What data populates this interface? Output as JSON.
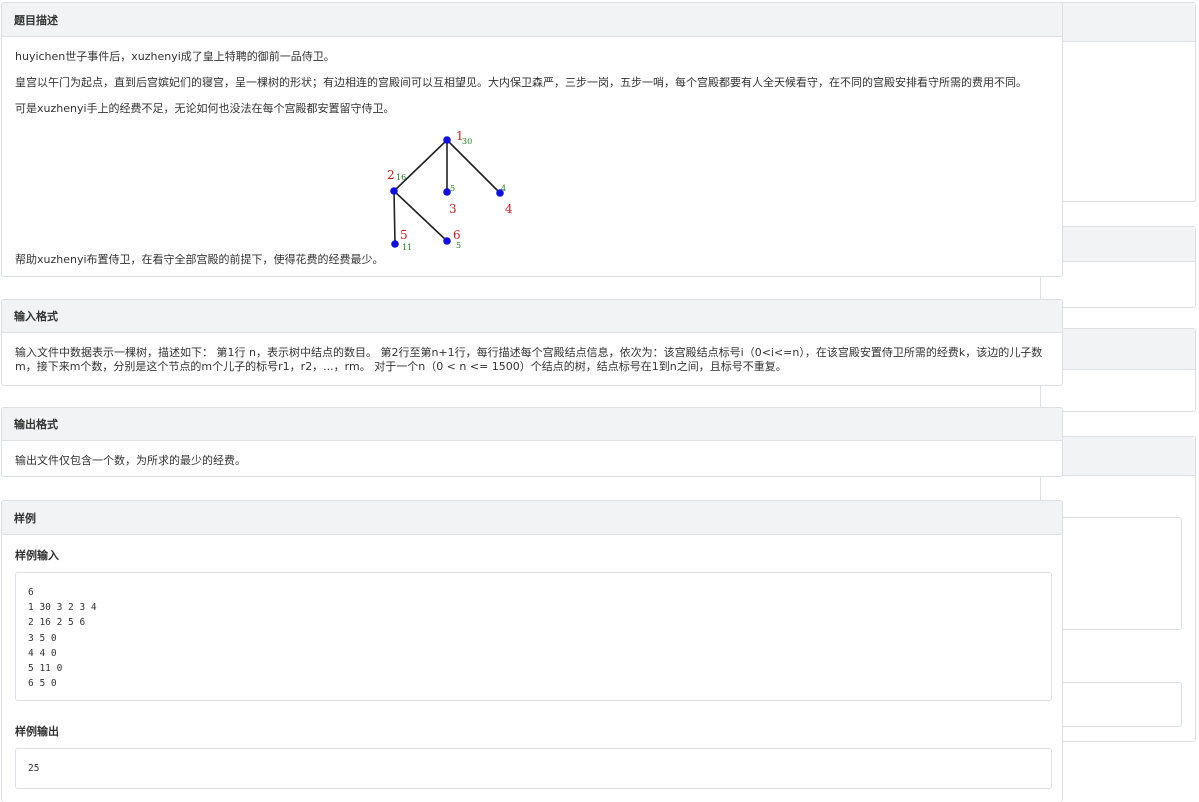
{
  "sections": {
    "description": {
      "title": "题目描述",
      "p1": "huyichen世子事件后，xuzhenyi成了皇上特聘的御前一品侍卫。",
      "p2": "皇宫以午门为起点，直到后宫嫔妃们的寝宫，呈一棵树的形状；有边相连的宫殿间可以互相望见。大内保卫森严，三步一岗，五步一哨，每个宫殿都要有人全天候看守，在不同的宫殿安排看守所需的费用不同。",
      "p3": "可是xuzhenyi手上的经费不足，无论如何也没法在每个宫殿都安置留守侍卫。",
      "p4": "帮助xuzhenyi布置侍卫，在看守全部宫殿的前提下，使得花费的经费最少。"
    },
    "input_format": {
      "title": "输入格式",
      "line1": "输入文件中数据表示一棵树，描述如下： 第1行 n，表示树中结点的数目。 第2行至第n+1行，每行描述每个宫殿结点信息，依次为：该宫殿结点标号i（0<i<=n），在该宫殿安置侍卫所需的经费k，该边的儿子数",
      "line2": "m，接下来m个数，分别是这个节点的m个儿子的标号r1，r2，...，rm。 对于一个n（0 < n <= 1500）个结点的树，结点标号在1到n之间，且标号不重复。"
    },
    "output_format": {
      "title": "输出格式",
      "text": "输出文件仅包含一个数，为所求的最少的经费。"
    },
    "sample": {
      "title": "样例",
      "input_title": "样例输入",
      "input_lines": [
        "6",
        "1 30 3 2 3 4",
        "2 16 2 5 6",
        "3 5 0",
        "4 4 0",
        "5 11 0",
        "6 5 0"
      ],
      "output_title": "样例输出",
      "output_value": "25"
    }
  },
  "tree_figure": {
    "node_color": "#1010e0",
    "id_color": "#d42020",
    "cost_color": "#208020",
    "nodes": [
      {
        "id": "1",
        "cost": "30"
      },
      {
        "id": "2",
        "cost": "16"
      },
      {
        "id": "3",
        "cost": "5"
      },
      {
        "id": "4",
        "cost": "4"
      },
      {
        "id": "5",
        "cost": "11"
      },
      {
        "id": "6",
        "cost": "5"
      }
    ]
  }
}
